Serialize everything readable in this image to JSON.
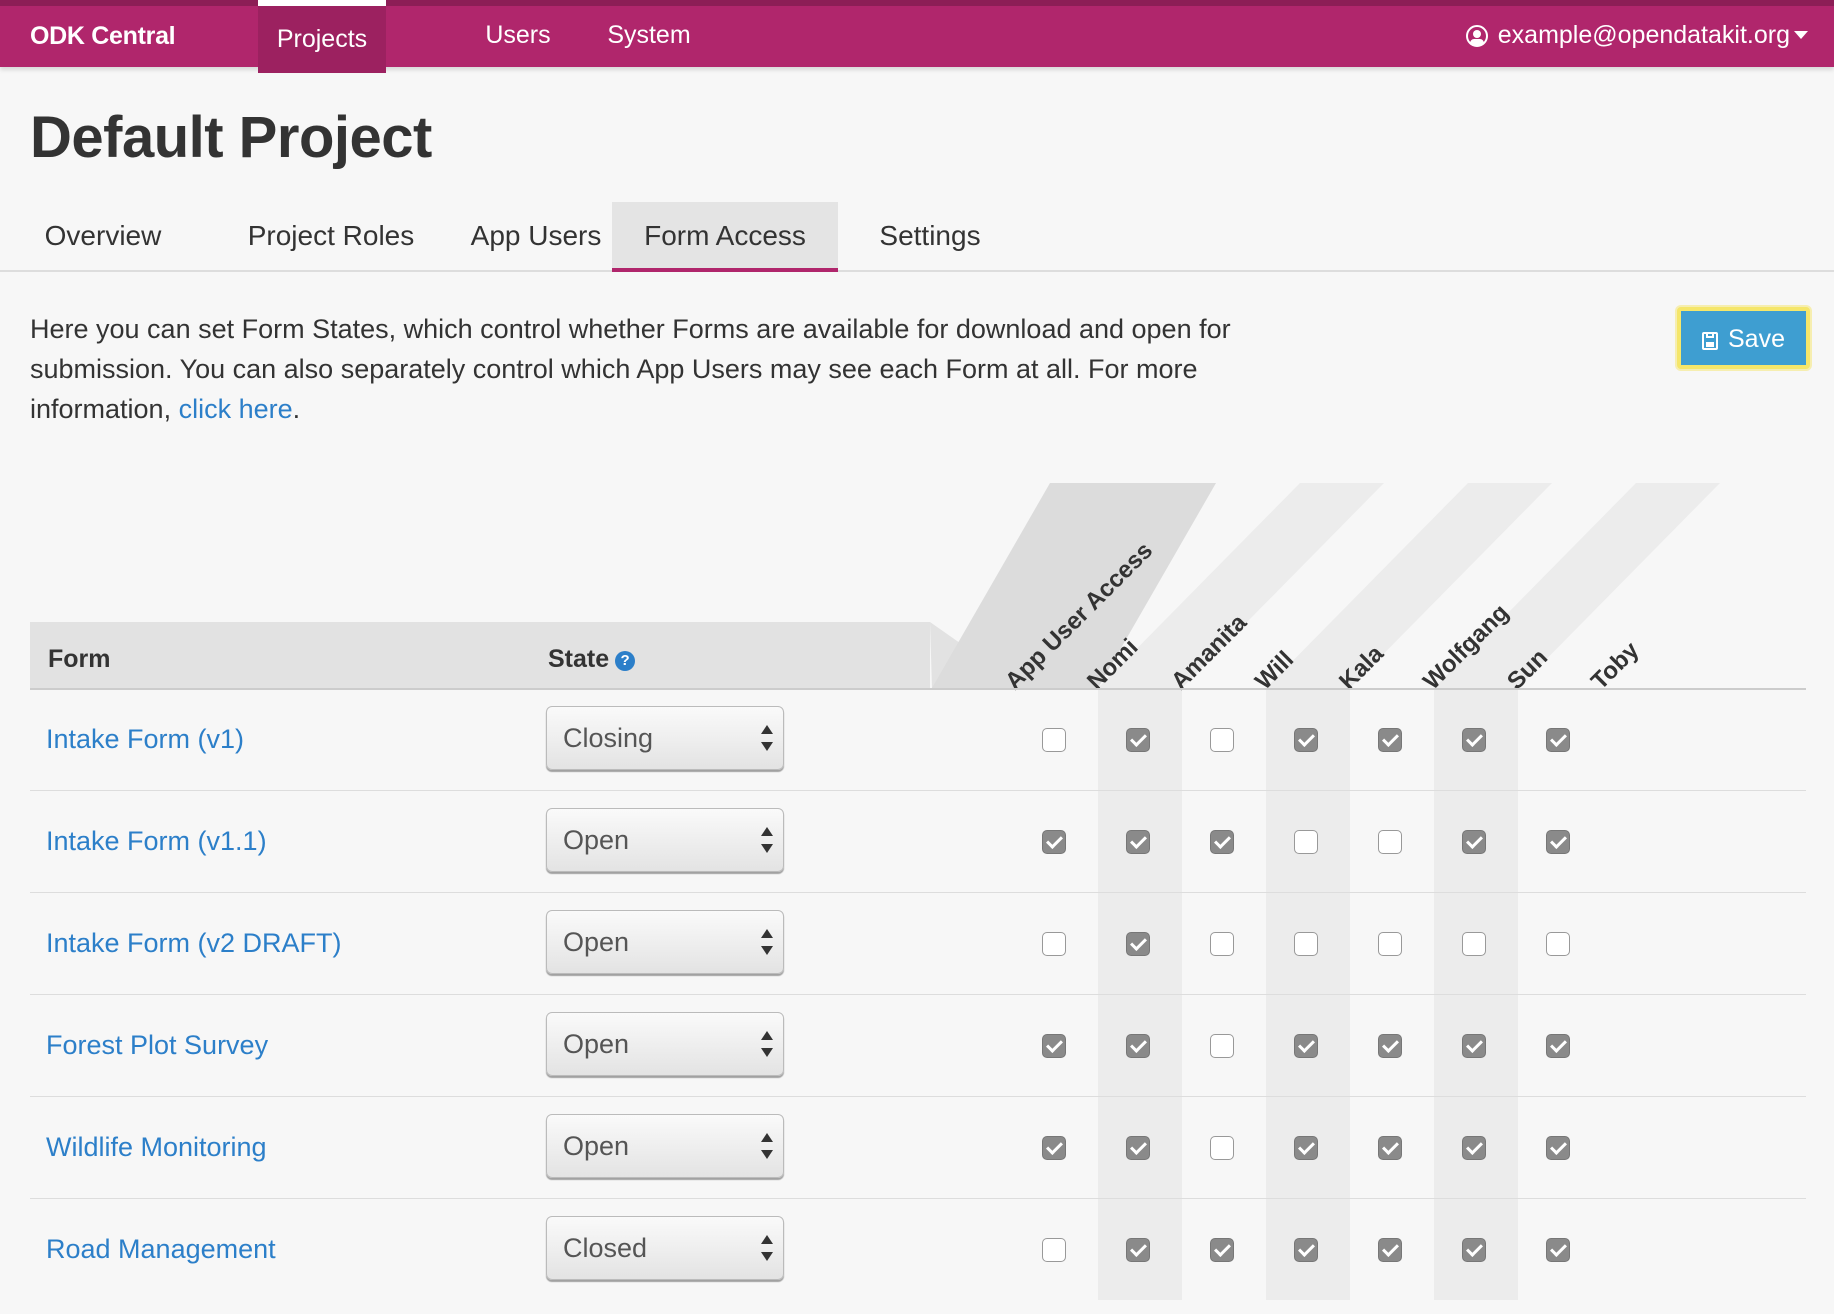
{
  "navbar": {
    "brand": "ODK Central",
    "items": [
      {
        "label": "Projects",
        "active": true
      },
      {
        "label": "Users",
        "active": false
      },
      {
        "label": "System",
        "active": false
      }
    ],
    "user_email": "example@opendatakit.org",
    "colors": {
      "bar": "#b0266c",
      "active": "#9c2160"
    }
  },
  "page": {
    "title": "Default Project",
    "tabs": [
      {
        "label": "Overview",
        "active": false
      },
      {
        "label": "Project Roles",
        "active": false
      },
      {
        "label": "App Users",
        "active": false
      },
      {
        "label": "Form Access",
        "active": true
      },
      {
        "label": "Settings",
        "active": false
      }
    ]
  },
  "intro": {
    "text_before": "Here you can set Form States, which control whether Forms are available for download and open for submission. You can also separately control which App Users may see each Form at all. For more information, ",
    "link_text": "click here",
    "text_after": "."
  },
  "save_button": {
    "label": "Save",
    "icon": "disk-icon"
  },
  "table": {
    "headers": {
      "form": "Form",
      "state": "State",
      "app_user_access": "App User Access"
    },
    "app_users": [
      "Nomi",
      "Amanita",
      "Will",
      "Kala",
      "Wolfgang",
      "Sun",
      "Toby"
    ],
    "rows": [
      {
        "form": "Intake Form (v1)",
        "state": "Closing",
        "access": [
          false,
          true,
          false,
          true,
          true,
          true,
          true
        ]
      },
      {
        "form": "Intake Form (v1.1)",
        "state": "Open",
        "access": [
          true,
          true,
          true,
          false,
          false,
          true,
          true
        ]
      },
      {
        "form": "Intake Form (v2 DRAFT)",
        "state": "Open",
        "access": [
          false,
          true,
          false,
          false,
          false,
          false,
          false
        ]
      },
      {
        "form": "Forest Plot Survey",
        "state": "Open",
        "access": [
          true,
          true,
          false,
          true,
          true,
          true,
          true
        ]
      },
      {
        "form": "Wildlife Monitoring",
        "state": "Open",
        "access": [
          true,
          true,
          false,
          true,
          true,
          true,
          true
        ]
      },
      {
        "form": "Road Management",
        "state": "Closed",
        "access": [
          false,
          true,
          true,
          true,
          true,
          true,
          true
        ]
      }
    ]
  }
}
